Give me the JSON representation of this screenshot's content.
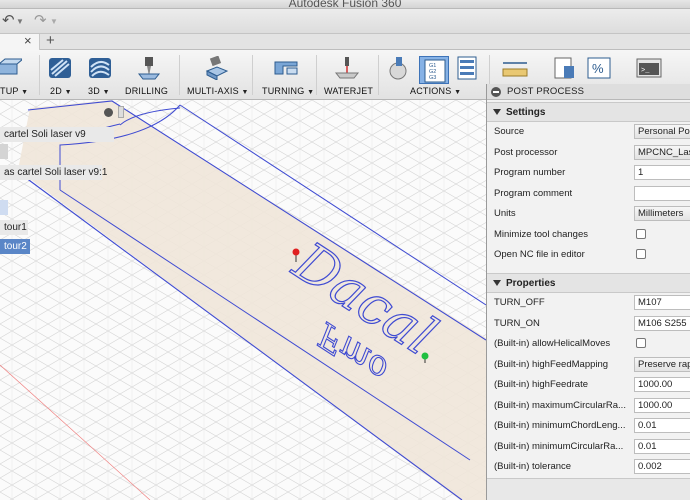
{
  "app": {
    "title": "Autodesk Fusion 360"
  },
  "toolbar": {
    "items": [
      {
        "label": "TUP",
        "icon": "setup-icon"
      },
      {
        "label": "2D",
        "icon": "2d-milling-icon"
      },
      {
        "label": "3D",
        "icon": "3d-milling-icon"
      },
      {
        "label": "DRILLING",
        "icon": "drilling-icon"
      },
      {
        "label": "MULTI-AXIS",
        "icon": "multi-axis-icon"
      },
      {
        "label": "TURNING",
        "icon": "turning-icon"
      },
      {
        "label": "WATERJET",
        "icon": "waterjet-icon"
      },
      {
        "label": "ACTIONS",
        "icon": "actions-icon"
      }
    ]
  },
  "browser": {
    "items": [
      "cartel Soli laser v9",
      "as cartel Soli laser v9:1",
      "tour1",
      "tour2"
    ]
  },
  "post_process": {
    "title": "POST PROCESS",
    "settings": {
      "header": "Settings",
      "rows": [
        {
          "label": "Source",
          "value": "Personal Post",
          "type": "select"
        },
        {
          "label": "Post processor",
          "value": "MPCNC_Laser",
          "type": "select"
        },
        {
          "label": "Program number",
          "value": "1",
          "type": "text"
        },
        {
          "label": "Program comment",
          "value": "",
          "type": "text"
        },
        {
          "label": "Units",
          "value": "Millimeters",
          "type": "select"
        },
        {
          "label": "Minimize tool changes",
          "value": "",
          "type": "checkbox"
        },
        {
          "label": "Open NC file in editor",
          "value": "",
          "type": "checkbox"
        }
      ]
    },
    "properties": {
      "header": "Properties",
      "rows": [
        {
          "label": "TURN_OFF",
          "value": "M107",
          "type": "text"
        },
        {
          "label": "TURN_ON",
          "value": "M106 S255",
          "type": "text"
        },
        {
          "label": "(Built-in) allowHelicalMoves",
          "value": "",
          "type": "checkbox"
        },
        {
          "label": "(Built-in) highFeedMapping",
          "value": "Preserve rapid",
          "type": "select"
        },
        {
          "label": "(Built-in) highFeedrate",
          "value": "1000.00",
          "type": "text"
        },
        {
          "label": "(Built-in) maximumCircularRa...",
          "value": "1000.00",
          "type": "text"
        },
        {
          "label": "(Built-in) minimumChordLeng...",
          "value": "0.01",
          "type": "text"
        },
        {
          "label": "(Built-in) minimumCircularRa...",
          "value": "0.01",
          "type": "text"
        },
        {
          "label": "(Built-in) tolerance",
          "value": "0.002",
          "type": "text"
        }
      ]
    }
  },
  "colors": {
    "accent": "#3f5bd2",
    "stock_fill": "#efe6d9",
    "selection": "#5a86c7",
    "panel_bg": "#f2f2f2"
  }
}
